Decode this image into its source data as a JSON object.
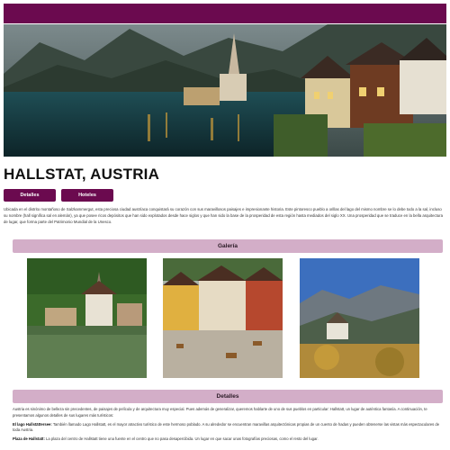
{
  "page": {
    "title": "HALLSTAT, AUSTRIA"
  },
  "tabs": [
    {
      "label": "Detalles"
    },
    {
      "label": "Hoteles"
    }
  ],
  "intro": "Ubicada en el distrito montañoso de Salzkammergut, esta preciosa ciudad austríaca conquistará su corazón con sus maravillosos paisajes e impresionante historia. Este pintoresco pueblo a orillas del lago del mismo nombre se lo debe todo a la sal, incluso su nombre (hall significa sal en alemán), ya que posee ricos depósitos que han sido explotados desde hace siglos y que han sido la base de la prosperidad de esta región hasta mediados del siglo XX. Una prosperidad que se traduce en la bella arquitectura de lugar, que forma parte del Patrimonio Mundial de la Unesco.",
  "gallery": {
    "title": "Galería"
  },
  "details": {
    "title": "Detalles",
    "paragraph": "Austria es sinónimo de belleza sin precedentes, de paisajes de película y de arquitectura muy especial. Pues además de generalizar, queremos hablarte de uno de sus pueblos en particular: Hallstatt, un lugar de auténtica fantasía. A continuación, te presentamos algunos detalles de sus lugares más turísticos:",
    "items": [
      {
        "label": "El lago Hallstättersee:",
        "text": " También llamado Lago Hallstatt, es el mayor atractivo turístico de este hermoso poblado. A su alrededor se encuentran maravillas arquitectónicas propias de un cuento de hadas y pueden obtenerse las vistas más espectaculares de toda Austria."
      },
      {
        "label": "Plaza de Hallstatt:",
        "text": " La plaza del centro de Hallstatt tiene una fuente en el centro que no pasa desapercibida. Un lugar en que sacar unas fotografías preciosas, como el resto del lugar."
      }
    ]
  },
  "colors": {
    "brand": "#6b0a4f",
    "section": "#d3aec8"
  },
  "icons": {
    "hero": "hallstatt-lake-village-photo",
    "gallery": [
      "village-church-lake-photo",
      "town-square-photo",
      "alpine-church-mountains-photo"
    ]
  }
}
